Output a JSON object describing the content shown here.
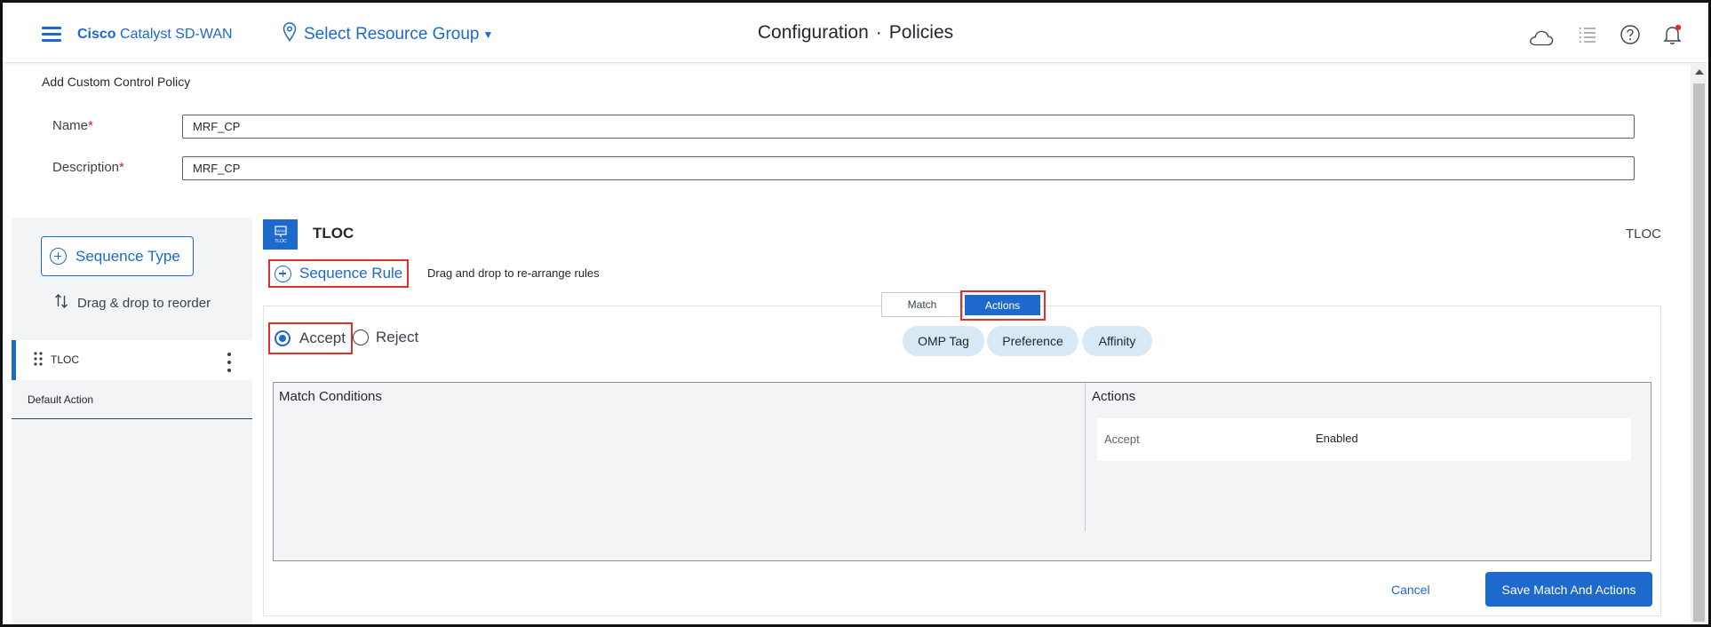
{
  "header": {
    "brand_bold": "Cisco",
    "brand_rest": "Catalyst SD-WAN",
    "resource_group": "Select Resource Group",
    "title_section": "Configuration",
    "title_separator": "·",
    "title_page": "Policies",
    "icons": [
      "menu-icon",
      "location-pin-icon",
      "cloud-icon",
      "list-icon",
      "help-icon",
      "bell-icon"
    ]
  },
  "form": {
    "section_title": "Add Custom Control Policy",
    "name_label": "Name",
    "name_value": "MRF_CP",
    "description_label": "Description",
    "description_value": "MRF_CP",
    "required_mark": "*"
  },
  "left_panel": {
    "sequence_type_label": "Sequence Type",
    "reorder_hint": "Drag & drop to reorder",
    "items": [
      {
        "label": "TLOC",
        "selected": true
      }
    ],
    "default_action": "Default Action"
  },
  "rule_editor": {
    "icon_caption": "TLOC",
    "title": "TLOC",
    "type_label": "TLOC",
    "sequence_rule_label": "Sequence Rule",
    "drag_hint": "Drag and drop to re-arrange rules",
    "tabs": [
      {
        "label": "Match",
        "active": false
      },
      {
        "label": "Actions",
        "active": true
      }
    ],
    "radios": {
      "accept": "Accept",
      "reject": "Reject",
      "selected": "Accept"
    },
    "action_pills": [
      "OMP Tag",
      "Preference",
      "Affinity"
    ],
    "conditions_header": "Match Conditions",
    "actions_header": "Actions",
    "actions_rows": [
      {
        "key": "Accept",
        "value": "Enabled"
      }
    ],
    "cancel_label": "Cancel",
    "save_label": "Save Match And Actions"
  },
  "colors": {
    "accent": "#1d69cc",
    "highlight_border": "#e0302b",
    "pill_bg": "#d9e8f5",
    "notification_dot": "#e0302b"
  }
}
